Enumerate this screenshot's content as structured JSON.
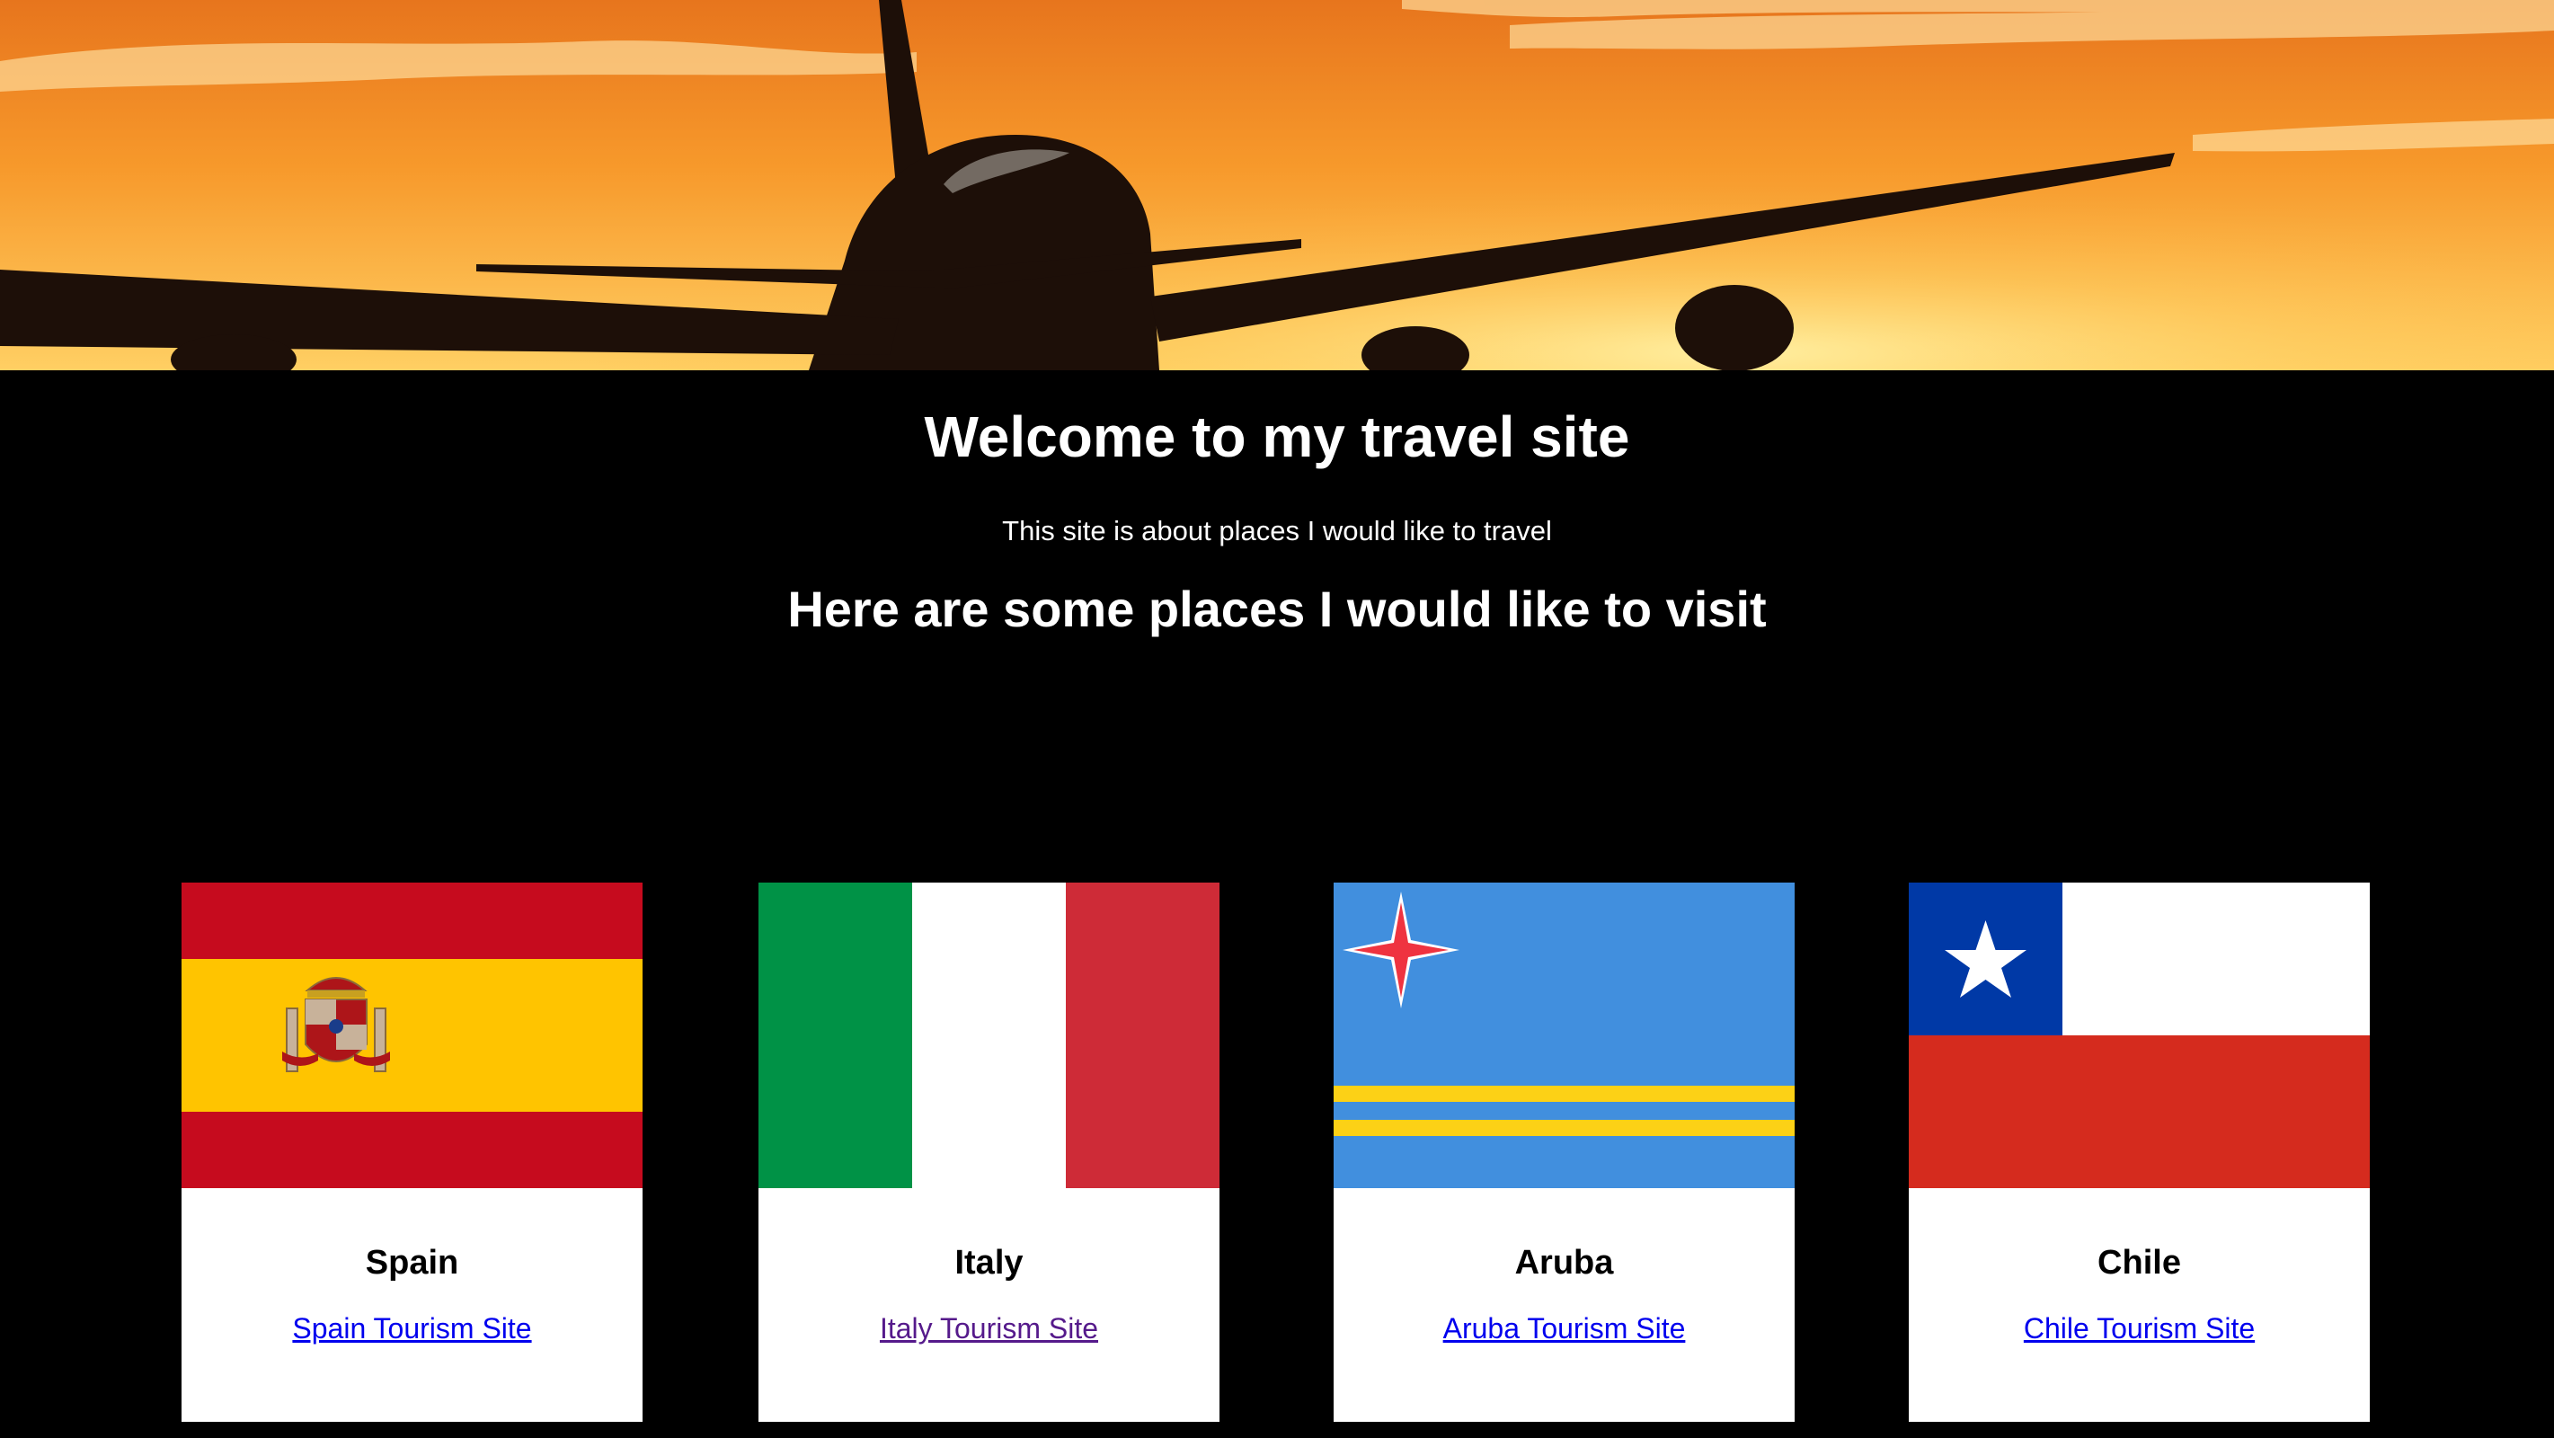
{
  "hero": {
    "image": "airplane-sunset-photo"
  },
  "page": {
    "title": "Welcome to my travel site",
    "subtitle": "This site is about places I would like to travel",
    "subheading": "Here are some places I would like to visit"
  },
  "cards": [
    {
      "name": "Spain",
      "link": "Spain Tourism Site",
      "visited": false,
      "flag": "spain-flag"
    },
    {
      "name": "Italy",
      "link": "Italy Tourism Site",
      "visited": true,
      "flag": "italy-flag"
    },
    {
      "name": "Aruba",
      "link": "Aruba Tourism Site",
      "visited": false,
      "flag": "aruba-flag"
    },
    {
      "name": "Chile",
      "link": "Chile Tourism Site",
      "visited": false,
      "flag": "chile-flag"
    }
  ],
  "colors": {
    "background": "#000000",
    "text": "#ffffff",
    "link": "#0000ee",
    "visited_link": "#551a8b"
  }
}
